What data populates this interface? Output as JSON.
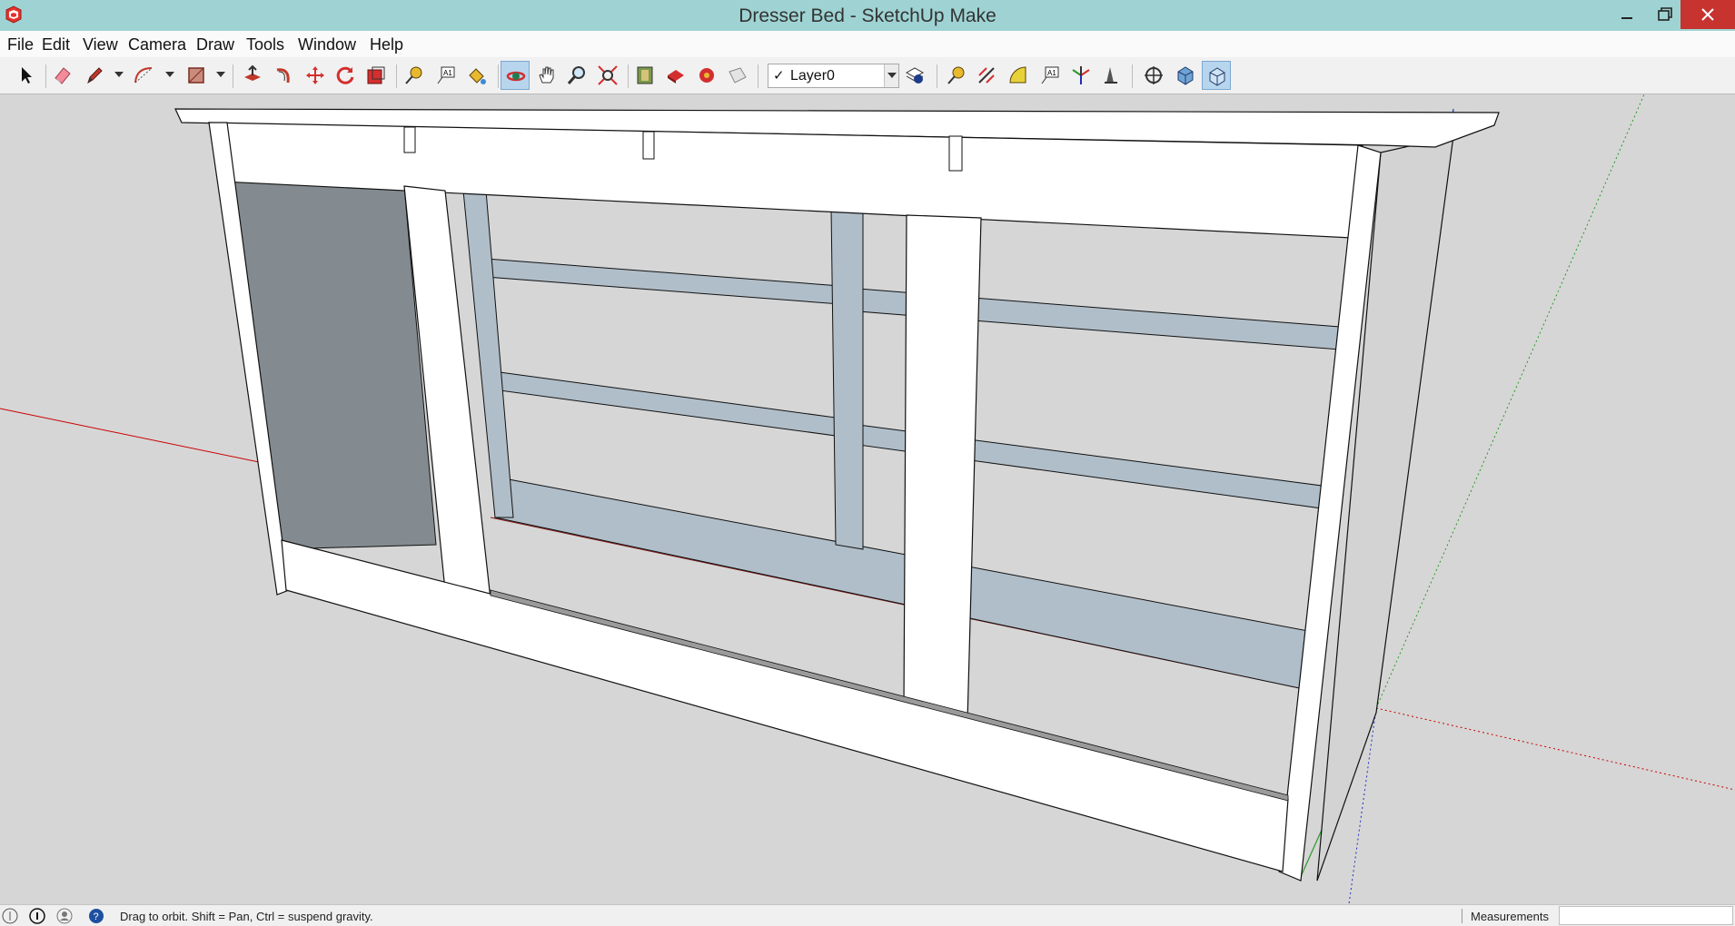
{
  "window": {
    "title": "Dresser Bed - SketchUp Make"
  },
  "menu": {
    "items": [
      "File",
      "Edit",
      "View",
      "Camera",
      "Draw",
      "Tools",
      "Window",
      "Help"
    ]
  },
  "toolbar": {
    "layer_check": "✓",
    "layer_value": "Layer0",
    "tools": [
      {
        "name": "select",
        "active": false
      },
      {
        "name": "eraser",
        "active": false
      },
      {
        "name": "pencil",
        "active": false
      },
      {
        "name": "arc",
        "active": false
      },
      {
        "name": "rectangle",
        "active": false
      },
      {
        "name": "push-pull",
        "active": false
      },
      {
        "name": "follow-me",
        "active": false
      },
      {
        "name": "move",
        "active": false
      },
      {
        "name": "rotate",
        "active": false
      },
      {
        "name": "scale",
        "active": false
      },
      {
        "name": "tape-measure",
        "active": false
      },
      {
        "name": "text",
        "active": false
      },
      {
        "name": "paint-bucket",
        "active": false
      },
      {
        "name": "orbit",
        "active": true
      },
      {
        "name": "pan",
        "active": false
      },
      {
        "name": "zoom",
        "active": false
      },
      {
        "name": "zoom-extents",
        "active": false
      },
      {
        "name": "warehouse",
        "active": false
      },
      {
        "name": "share-model",
        "active": false
      },
      {
        "name": "components",
        "active": false
      },
      {
        "name": "extensions",
        "active": false
      },
      {
        "name": "layer-manager",
        "active": false
      },
      {
        "name": "dimension",
        "active": false
      },
      {
        "name": "protractor",
        "active": false
      },
      {
        "name": "axes",
        "active": false
      },
      {
        "name": "section-plane",
        "active": false
      },
      {
        "name": "position-camera",
        "active": false
      },
      {
        "name": "iso-view",
        "active": false
      },
      {
        "name": "perspective-view",
        "active": true
      }
    ]
  },
  "status": {
    "hint": "Drag to orbit. Shift = Pan, Ctrl = suspend gravity.",
    "measurements_label": "Measurements",
    "measurements_value": ""
  },
  "colors": {
    "titlebar": "#9fd3d3",
    "close_button": "#c7332f",
    "background": "#d6d6d6",
    "model_face": "#ffffff",
    "model_back_face": "#b0bec9",
    "model_shadow": "#838b90",
    "axis_red": "#cc0000",
    "axis_green": "#2a9a2a",
    "axis_blue": "#1f2fbf"
  }
}
